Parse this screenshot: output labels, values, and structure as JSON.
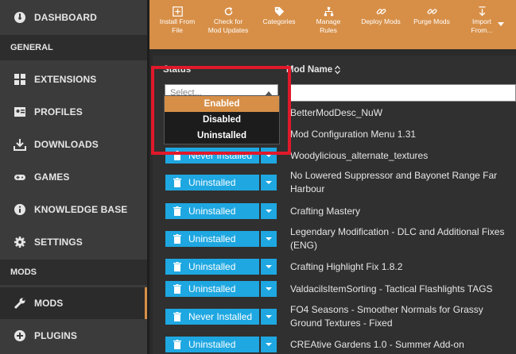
{
  "sidebar": {
    "items": [
      {
        "label": "DASHBOARD",
        "icon": "dashboard-icon"
      },
      {
        "label": "EXTENSIONS",
        "icon": "extensions-icon"
      },
      {
        "label": "PROFILES",
        "icon": "profiles-icon"
      },
      {
        "label": "DOWNLOADS",
        "icon": "download-icon"
      },
      {
        "label": "GAMES",
        "icon": "gamepad-icon"
      },
      {
        "label": "KNOWLEDGE BASE",
        "icon": "info-icon"
      },
      {
        "label": "SETTINGS",
        "icon": "gear-icon"
      },
      {
        "label": "MODS",
        "icon": "wrench-icon"
      },
      {
        "label": "PLUGINS",
        "icon": "plus-circle-icon"
      }
    ],
    "sections": {
      "general": "GENERAL",
      "mods": "MODS"
    }
  },
  "toolbar": {
    "buttons": [
      {
        "label": "Install From File",
        "l1": "Install From",
        "l2": "File",
        "icon": "install-icon"
      },
      {
        "label": "Check for Mod Updates",
        "l1": "Check for",
        "l2": "Mod Updates",
        "icon": "refresh-icon"
      },
      {
        "label": "Categories",
        "l1": "Categories",
        "l2": "",
        "icon": "tag-icon"
      },
      {
        "label": "Manage Rules",
        "l1": "Manage",
        "l2": "Rules",
        "icon": "rules-icon"
      },
      {
        "label": "Deploy Mods",
        "l1": "Deploy Mods",
        "l2": "",
        "icon": "link-icon"
      },
      {
        "label": "Purge Mods",
        "l1": "Purge Mods",
        "l2": "",
        "icon": "unlink-icon"
      },
      {
        "label": "Import From...",
        "l1": "Import",
        "l2": "From...",
        "icon": "import-icon"
      }
    ]
  },
  "table": {
    "status_header": "Status",
    "name_header": "Mod Name",
    "status_placeholder": "Select...",
    "rows": [
      {
        "status": "",
        "name": "BetterModDesc_NuW"
      },
      {
        "status": "",
        "name": "Mod Configuration Menu 1.31"
      },
      {
        "status": "Never Installed",
        "name": "Woodylicious_alternate_textures"
      },
      {
        "status": "Uninstalled",
        "name": "No Lowered Suppressor and Bayonet Range Far Harbour"
      },
      {
        "status": "Uninstalled",
        "name": "Crafting Mastery"
      },
      {
        "status": "Uninstalled",
        "name": "Legendary Modification - DLC and Additional Fixes (ENG)"
      },
      {
        "status": "Uninstalled",
        "name": "Crafting Highlight Fix 1.8.2"
      },
      {
        "status": "Uninstalled",
        "name": "ValdacilsItemSorting - Tactical Flashlights TAGS"
      },
      {
        "status": "Never Installed",
        "name": "FO4 Seasons - Smoother Normals for Grassy Ground Textures - Fixed"
      },
      {
        "status": "Uninstalled",
        "name": "CREAtive Gardens 1.0 - Summer Add-on"
      }
    ]
  },
  "dropdown": {
    "options": [
      "Enabled",
      "Disabled",
      "Uninstalled"
    ],
    "selected": "Enabled"
  },
  "colors": {
    "accent": "#d78f47",
    "status_button": "#1ea7e1",
    "highlight": "#e0192b"
  }
}
